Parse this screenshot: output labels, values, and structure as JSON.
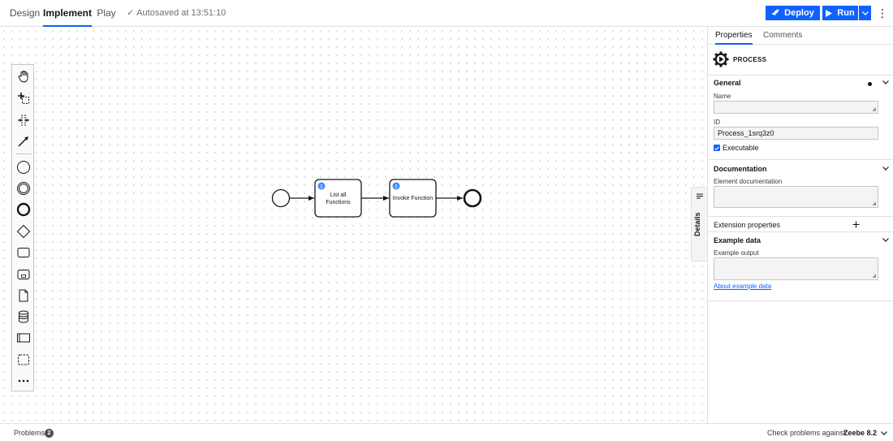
{
  "tabs": [
    {
      "label": "Design"
    },
    {
      "label": "Implement"
    },
    {
      "label": "Play"
    }
  ],
  "autosave": "Autosaved at 13:51:10",
  "actions": {
    "deploy": "Deploy",
    "run": "Run"
  },
  "diagram": {
    "task1": {
      "line1": "List all",
      "line2": "Functions"
    },
    "task2": {
      "label": "Invoke Function"
    }
  },
  "details_label": "Details",
  "panel": {
    "tabs": [
      {
        "label": "Properties"
      },
      {
        "label": "Comments"
      }
    ],
    "element_type": "PROCESS",
    "general": {
      "title": "General",
      "name_label": "Name",
      "name_value": "",
      "id_label": "ID",
      "id_value": "Process_1srq3z0",
      "executable_label": "Executable"
    },
    "documentation": {
      "title": "Documentation",
      "element_doc_label": "Element documentation",
      "element_doc_value": ""
    },
    "extension": {
      "title": "Extension properties"
    },
    "example": {
      "title": "Example data",
      "output_label": "Example output",
      "output_value": "",
      "link": "About example data"
    }
  },
  "bottom": {
    "problems_label": "Problems",
    "problems_count": "2",
    "check_label": "Check problems against:",
    "engine": "Zeebe 8.2"
  },
  "colors": {
    "accent": "#0f62fe",
    "task_badge": "#4589ff"
  }
}
